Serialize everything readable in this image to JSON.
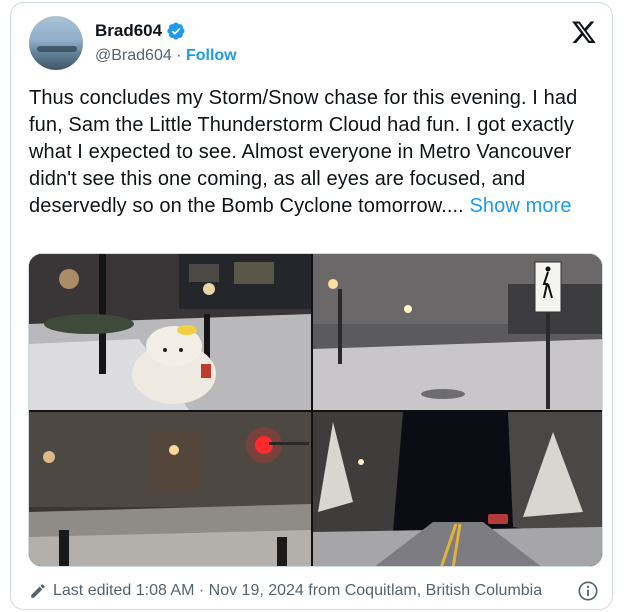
{
  "tweet": {
    "author": {
      "display_name": "Brad604",
      "handle": "@Brad604",
      "separator": " · ",
      "follow_label": "Follow"
    },
    "text": "Thus concludes my Storm/Snow chase for this evening. I had fun, Sam the Little Thunderstorm Cloud had fun. I got exactly what I expected to see. Almost everyone in Metro Vancouver didn't see this one coming, as all eyes are focused, and deservedly so on the Bomb Cyclone tomorrow....",
    "show_more_label": "Show more",
    "footer": {
      "edited_text": "Last edited 1:08 AM · Nov 19, 2024 from Coquitlam, British Columbia"
    }
  },
  "colors": {
    "accent": "#1d9bf0",
    "text": "#0f1419",
    "muted": "#536471",
    "border": "#cfd9de"
  },
  "icons": {
    "verified": "verified-badge-icon",
    "brand": "x-logo-icon",
    "edit": "pencil-icon",
    "info": "info-icon"
  }
}
